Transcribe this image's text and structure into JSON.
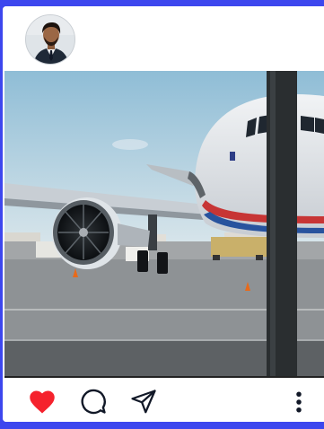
{
  "post": {
    "avatar_icon": "user-avatar-photo",
    "photo_subject": "airplane-photo",
    "actions": {
      "like_icon": "heart-icon",
      "like_color": "#f5222d",
      "comment_icon": "speech-bubble-icon",
      "share_icon": "paper-plane-icon",
      "more_icon": "vertical-dots-icon"
    }
  },
  "colors": {
    "frame": "#3d47ee",
    "card": "#ffffff"
  }
}
